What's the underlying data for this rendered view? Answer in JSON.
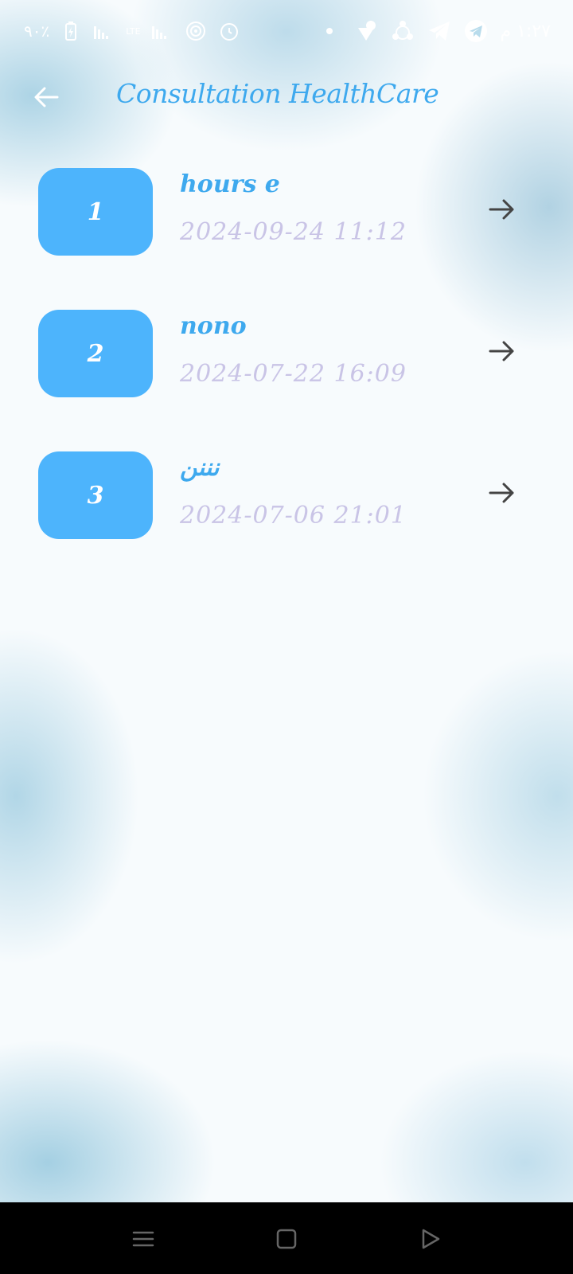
{
  "status_bar": {
    "time": "١:٢٧ م",
    "battery": "٩٠٪",
    "network": "LTE"
  },
  "header": {
    "title": "Consultation HealthCare"
  },
  "consultations": [
    {
      "number": "1",
      "name": "hours e",
      "datetime": "2024-09-24 11:12"
    },
    {
      "number": "2",
      "name": "nono",
      "datetime": "2024-07-22 16:09"
    },
    {
      "number": "3",
      "name": "نننن",
      "datetime": "2024-07-06 21:01"
    }
  ],
  "colors": {
    "accent": "#3ea9ee",
    "badge": "#4db4fc",
    "date": "#c9c4e6",
    "arrow": "#444444"
  },
  "icons": {
    "back": "arrow-left-icon",
    "row": "arrow-right-icon",
    "nav_menu": "menu-icon",
    "nav_home": "square-icon",
    "nav_back": "triangle-icon"
  }
}
